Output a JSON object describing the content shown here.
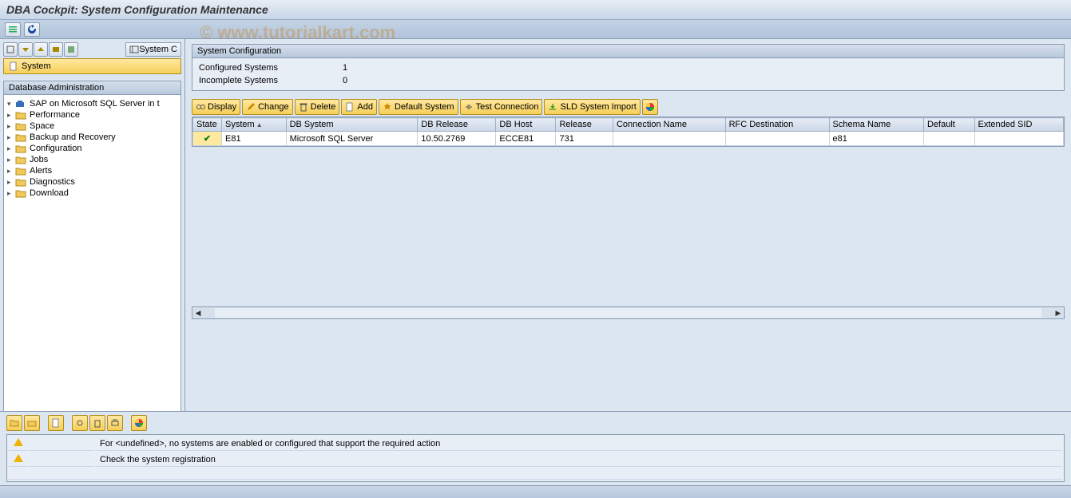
{
  "title": "DBA Cockpit: System Configuration Maintenance",
  "watermark": "© www.tutorialkart.com",
  "sidebar": {
    "system_c_label": "System C",
    "system_label": "System",
    "panel_title": "Database Administration",
    "root": "SAP on Microsoft SQL Server in t",
    "items": [
      "Performance",
      "Space",
      "Backup and Recovery",
      "Configuration",
      "Jobs",
      "Alerts",
      "Diagnostics",
      "Download"
    ]
  },
  "config": {
    "panel_title": "System Configuration",
    "rows": [
      {
        "label": "Configured Systems",
        "value": "1"
      },
      {
        "label": "Incomplete Systems",
        "value": "0"
      }
    ]
  },
  "actions": {
    "display": "Display",
    "change": "Change",
    "delete": "Delete",
    "add": "Add",
    "default": "Default System",
    "test": "Test Connection",
    "sld": "SLD System Import"
  },
  "grid": {
    "headers": [
      "State",
      "System",
      "DB System",
      "DB Release",
      "DB Host",
      "Release",
      "Connection Name",
      "RFC Destination",
      "Schema Name",
      "Default",
      "Extended SID"
    ],
    "row": {
      "state": "ok",
      "system": "E81",
      "db_system": "Microsoft SQL Server",
      "db_release": "10.50.2769",
      "db_host": "ECCE81",
      "release": "731",
      "conn": "",
      "rfc": "",
      "schema": "e81",
      "default": "",
      "ext": ""
    }
  },
  "messages": [
    "For <undefined>, no systems are enabled or configured that support the required action",
    "Check the system registration"
  ]
}
